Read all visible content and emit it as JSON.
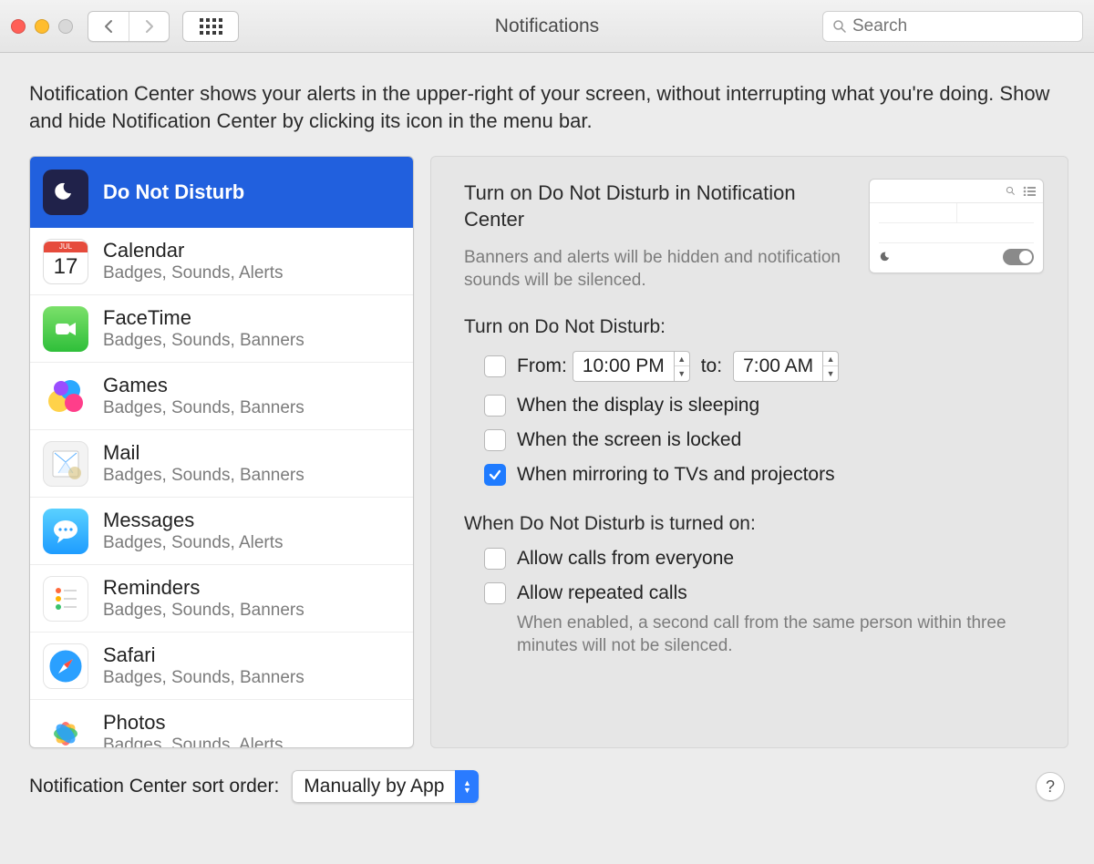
{
  "window": {
    "title": "Notifications",
    "search_placeholder": "Search"
  },
  "intro": "Notification Center shows your alerts in the upper-right of your screen, without interrupting what you're doing. Show and hide Notification Center by clicking its icon in the menu bar.",
  "sidebar": {
    "items": [
      {
        "name": "Do Not Disturb",
        "sub": ""
      },
      {
        "name": "Calendar",
        "sub": "Badges, Sounds, Alerts",
        "cal_month": "JUL",
        "cal_day": "17"
      },
      {
        "name": "FaceTime",
        "sub": "Badges, Sounds, Banners"
      },
      {
        "name": "Games",
        "sub": "Badges, Sounds, Banners"
      },
      {
        "name": "Mail",
        "sub": "Badges, Sounds, Banners"
      },
      {
        "name": "Messages",
        "sub": "Badges, Sounds, Alerts"
      },
      {
        "name": "Reminders",
        "sub": "Badges, Sounds, Banners"
      },
      {
        "name": "Safari",
        "sub": "Badges, Sounds, Banners"
      },
      {
        "name": "Photos",
        "sub": "Badges, Sounds, Alerts"
      }
    ]
  },
  "detail": {
    "heading": "Turn on Do Not Disturb in Notification Center",
    "heading_desc": "Banners and alerts will be hidden and notification sounds will be silenced.",
    "section1": "Turn on Do Not Disturb:",
    "from_label": "From:",
    "from_value": "10:00 PM",
    "to_label": "to:",
    "to_value": "7:00 AM",
    "opt_sleep": "When the display is sleeping",
    "opt_locked": "When the screen is locked",
    "opt_mirror": "When mirroring to TVs and projectors",
    "section2": "When Do Not Disturb is turned on:",
    "opt_everyone": "Allow calls from everyone",
    "opt_repeated": "Allow repeated calls",
    "repeated_hint": "When enabled, a second call from the same person within three minutes will not be silenced."
  },
  "footer": {
    "sort_label": "Notification Center sort order:",
    "sort_value": "Manually by App"
  }
}
